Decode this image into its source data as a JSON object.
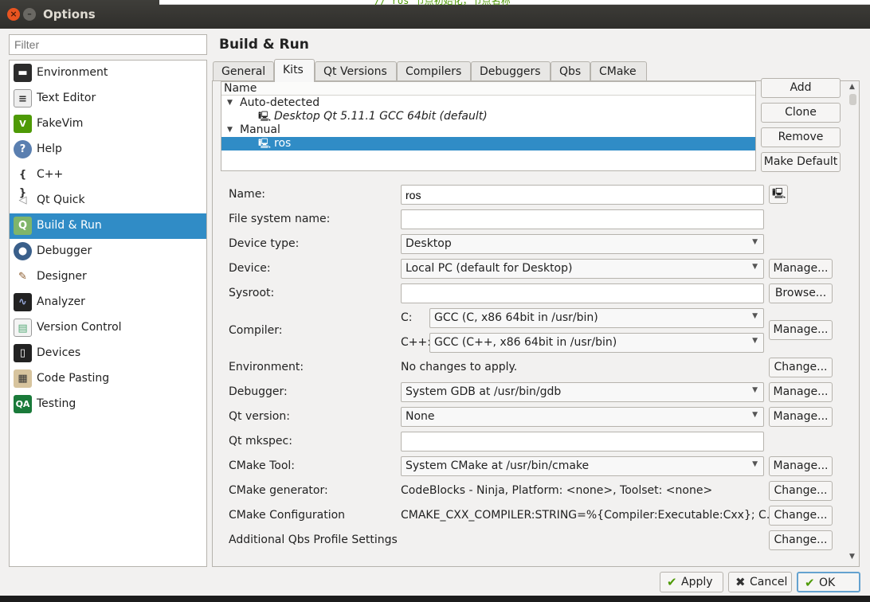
{
  "window": {
    "title": "Options",
    "behind_code": "// ros 节点初始化，节点名称"
  },
  "filter": {
    "placeholder": "Filter"
  },
  "sidebar": {
    "items": [
      {
        "label": "Environment",
        "icon": "monitor-icon"
      },
      {
        "label": "Text Editor",
        "icon": "text-editor-icon"
      },
      {
        "label": "FakeVim",
        "icon": "fakevim-icon"
      },
      {
        "label": "Help",
        "icon": "help-icon"
      },
      {
        "label": "C++",
        "icon": "braces-icon"
      },
      {
        "label": "Qt Quick",
        "icon": "paper-plane-icon"
      },
      {
        "label": "Build & Run",
        "icon": "qt-build-icon",
        "selected": true
      },
      {
        "label": "Debugger",
        "icon": "bug-icon"
      },
      {
        "label": "Designer",
        "icon": "brush-icon"
      },
      {
        "label": "Analyzer",
        "icon": "oscilloscope-icon"
      },
      {
        "label": "Version Control",
        "icon": "document-icon"
      },
      {
        "label": "Devices",
        "icon": "tablet-icon"
      },
      {
        "label": "Code Pasting",
        "icon": "clipboard-icon"
      },
      {
        "label": "Testing",
        "icon": "qa-icon"
      }
    ]
  },
  "section": {
    "title": "Build & Run"
  },
  "tabs": [
    "General",
    "Kits",
    "Qt Versions",
    "Compilers",
    "Debuggers",
    "Qbs",
    "CMake"
  ],
  "active_tab": "Kits",
  "tree": {
    "header": "Name",
    "groups": [
      {
        "label": "Auto-detected",
        "kits": [
          "Desktop Qt 5.11.1 GCC 64bit (default)"
        ]
      },
      {
        "label": "Manual",
        "kits": [
          "ros"
        ]
      }
    ]
  },
  "kit_buttons": {
    "add": "Add",
    "clone": "Clone",
    "remove": "Remove",
    "make_default": "Make Default"
  },
  "form": {
    "name": {
      "label": "Name:",
      "value": "ros"
    },
    "fs_name": {
      "label": "File system name:",
      "value": ""
    },
    "device_type": {
      "label": "Device type:",
      "value": "Desktop"
    },
    "device": {
      "label": "Device:",
      "value": "Local PC (default for Desktop)",
      "button": "Manage..."
    },
    "sysroot": {
      "label": "Sysroot:",
      "value": "",
      "button": "Browse..."
    },
    "compiler": {
      "label": "Compiler:",
      "c_label": "C:",
      "c_value": "GCC (C, x86 64bit in /usr/bin)",
      "cxx_label": "C++:",
      "cxx_value": "GCC (C++, x86 64bit in /usr/bin)",
      "button": "Manage..."
    },
    "environment": {
      "label": "Environment:",
      "value": "No changes to apply.",
      "button": "Change..."
    },
    "debugger": {
      "label": "Debugger:",
      "value": "System GDB at /usr/bin/gdb",
      "button": "Manage..."
    },
    "qt_version": {
      "label": "Qt version:",
      "value": "None",
      "button": "Manage..."
    },
    "qt_mkspec": {
      "label": "Qt mkspec:",
      "value": ""
    },
    "cmake_tool": {
      "label": "CMake Tool:",
      "value": "System CMake at /usr/bin/cmake",
      "button": "Manage..."
    },
    "cmake_generator": {
      "label": "CMake generator:",
      "value": "CodeBlocks - Ninja, Platform: <none>, Toolset: <none>",
      "button": "Change..."
    },
    "cmake_config": {
      "label": "CMake Configuration",
      "value": "CMAKE_CXX_COMPILER:STRING=%{Compiler:Executable:Cxx}; C...",
      "button": "Change..."
    },
    "qbs_profile": {
      "label": "Additional Qbs Profile Settings",
      "button": "Change..."
    }
  },
  "footer": {
    "apply": "Apply",
    "cancel": "Cancel",
    "ok": "OK"
  },
  "colors": {
    "selection": "#308cc6",
    "titlebar": "#3c3b37",
    "close": "#e95420"
  }
}
